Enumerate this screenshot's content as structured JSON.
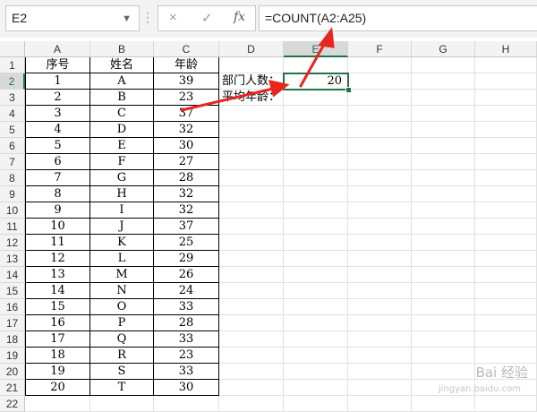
{
  "formula_bar": {
    "name_box": "E2",
    "more_icon": "vertical-ellipsis-icon",
    "cancel_icon": "×",
    "enter_icon": "✓",
    "fx_icon": "fx",
    "formula": "=COUNT(A2:A25)"
  },
  "columns": [
    "A",
    "B",
    "C",
    "D",
    "E",
    "F",
    "G",
    "H"
  ],
  "selected_column": "E",
  "rows": [
    "1",
    "2",
    "3",
    "4",
    "5",
    "6",
    "7",
    "8",
    "9",
    "10",
    "11",
    "12",
    "13",
    "14",
    "15",
    "16",
    "17",
    "18",
    "19",
    "20",
    "21",
    "22"
  ],
  "selected_row": "2",
  "table": {
    "headers": [
      "序号",
      "姓名",
      "年龄"
    ],
    "records": [
      [
        "1",
        "A",
        "39"
      ],
      [
        "2",
        "B",
        "23"
      ],
      [
        "3",
        "C",
        "37"
      ],
      [
        "4",
        "D",
        "32"
      ],
      [
        "5",
        "E",
        "30"
      ],
      [
        "6",
        "F",
        "27"
      ],
      [
        "7",
        "G",
        "28"
      ],
      [
        "8",
        "H",
        "32"
      ],
      [
        "9",
        "I",
        "32"
      ],
      [
        "10",
        "J",
        "37"
      ],
      [
        "11",
        "K",
        "25"
      ],
      [
        "12",
        "L",
        "29"
      ],
      [
        "13",
        "M",
        "26"
      ],
      [
        "14",
        "N",
        "24"
      ],
      [
        "15",
        "O",
        "33"
      ],
      [
        "16",
        "P",
        "28"
      ],
      [
        "17",
        "Q",
        "33"
      ],
      [
        "18",
        "R",
        "23"
      ],
      [
        "19",
        "S",
        "33"
      ],
      [
        "20",
        "T",
        "30"
      ]
    ]
  },
  "summary": {
    "dept_count_label": "部门人数：",
    "dept_count_value": "20",
    "avg_age_label": "平均年龄："
  },
  "watermark": {
    "text": "Bai 经验",
    "sub": "jingyan.baidu.com"
  },
  "colors": {
    "accent": "#217346",
    "arrow": "#e8251f"
  }
}
